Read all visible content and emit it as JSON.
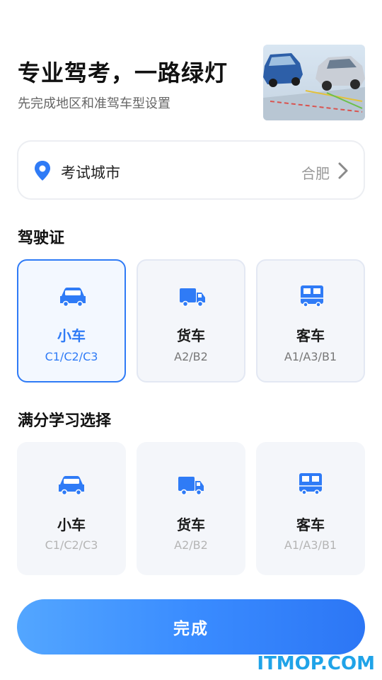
{
  "header": {
    "title": "专业驾考，一路绿灯",
    "subtitle": "先完成地区和准驾车型设置"
  },
  "city": {
    "label": "考试城市",
    "value": "合肥"
  },
  "license_section": {
    "title": "驾驶证",
    "cards": [
      {
        "name": "小车",
        "code": "C1/C2/C3",
        "icon": "car-icon",
        "selected": true
      },
      {
        "name": "货车",
        "code": "A2/B2",
        "icon": "truck-icon",
        "selected": false
      },
      {
        "name": "客车",
        "code": "A1/A3/B1",
        "icon": "bus-icon",
        "selected": false
      }
    ]
  },
  "fullscore_section": {
    "title": "满分学习选择",
    "cards": [
      {
        "name": "小车",
        "code": "C1/C2/C3",
        "icon": "car-icon",
        "selected": false
      },
      {
        "name": "货车",
        "code": "A2/B2",
        "icon": "truck-icon",
        "selected": false
      },
      {
        "name": "客车",
        "code": "A1/A3/B1",
        "icon": "bus-icon",
        "selected": false
      }
    ]
  },
  "done_button": {
    "label": "完成"
  },
  "watermark": "ITMOP.COM",
  "colors": {
    "accent": "#2f7bf6",
    "button_gradient_start": "#53a6ff",
    "button_gradient_end": "#2c76f5",
    "watermark": "#1fa3e8"
  }
}
